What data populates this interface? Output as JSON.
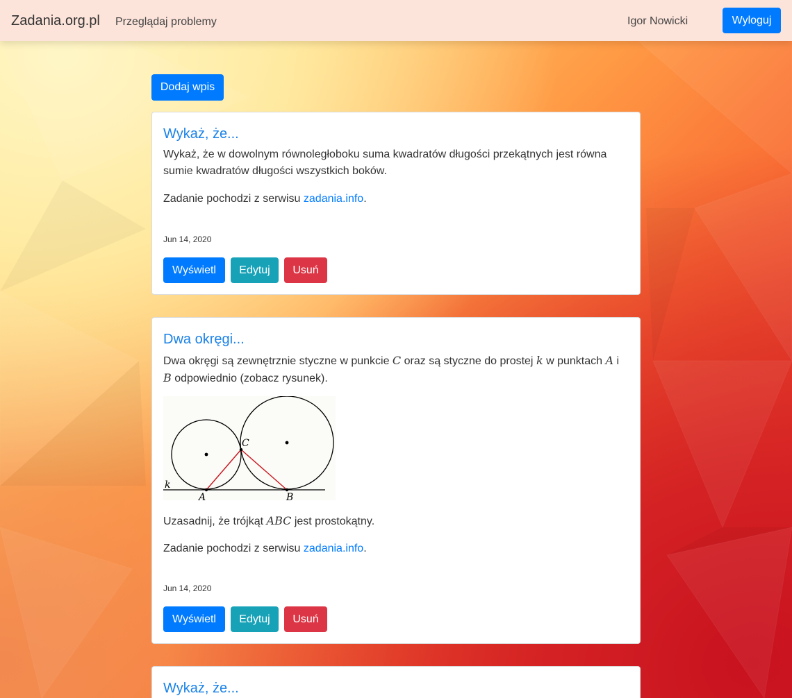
{
  "navbar": {
    "brand": "Zadania.org.pl",
    "browse_link": "Przeglądaj problemy",
    "user_name": "Igor Nowicki",
    "logout_label": "Wyloguj"
  },
  "toolbar": {
    "add_entry_label": "Dodaj wpis"
  },
  "colors": {
    "primary": "#007bff",
    "info": "#17a2b8",
    "danger": "#dc3545",
    "navbar_bg": "#fde4da"
  },
  "posts": [
    {
      "title": "Wykaż, że...",
      "body": "Wykaż, że w dowolnym równoległoboku suma kwadratów długości przekątnych jest równa sumie kwadratów długości wszystkich boków.",
      "source_prefix": "Zadanie pochodzi z serwisu ",
      "source_link": "zadania.info",
      "source_suffix": ".",
      "date": "Jun 14, 2020",
      "view_label": "Wyświetl",
      "edit_label": "Edytuj",
      "delete_label": "Usuń"
    },
    {
      "title": "Dwa okręgi...",
      "body_part1": "Dwa okręgi są zewnętrznie styczne w punkcie ",
      "body_math1": "C",
      "body_part2": " oraz są styczne do prostej ",
      "body_math2": "k",
      "body_part3": " w punktach ",
      "body_math3": "A",
      "body_part4": " i ",
      "body_math4": "B",
      "body_part5": " odpowiednio (zobacz rysunek).",
      "figure_labels": {
        "line": "k",
        "point_a": "A",
        "point_b": "B",
        "point_c": "C"
      },
      "question_part1": "Uzasadnij, że trójkąt ",
      "question_math": "ABC",
      "question_part2": " jest prostokątny.",
      "source_prefix": "Zadanie pochodzi z serwisu ",
      "source_link": "zadania.info",
      "source_suffix": ".",
      "date": "Jun 14, 2020",
      "view_label": "Wyświetl",
      "edit_label": "Edytuj",
      "delete_label": "Usuń"
    },
    {
      "title": "Wykaż, że..."
    }
  ]
}
